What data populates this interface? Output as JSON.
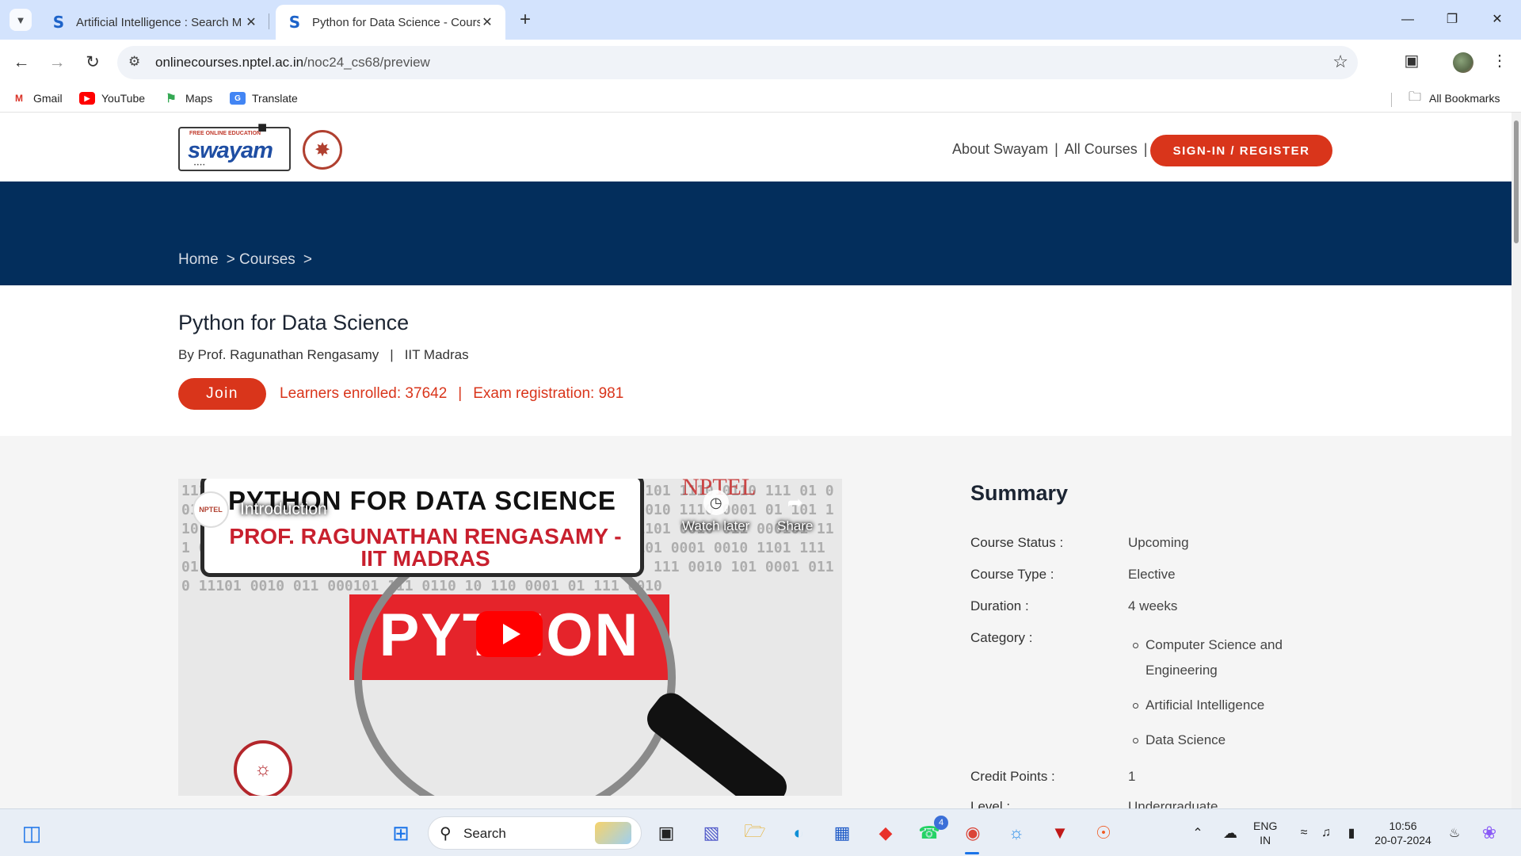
{
  "browser": {
    "tabs": [
      {
        "title": "Artificial Intelligence : Search M",
        "favicon": "S",
        "active": false
      },
      {
        "title": "Python for Data Science - Cours",
        "favicon": "S",
        "active": true
      }
    ],
    "url_host": "onlinecourses.nptel.ac.in",
    "url_path": "/noc24_cs68/preview",
    "bookmarks": [
      {
        "label": "Gmail",
        "icon": "gmail-icon"
      },
      {
        "label": "YouTube",
        "icon": "youtube-icon"
      },
      {
        "label": "Maps",
        "icon": "maps-icon"
      },
      {
        "label": "Translate",
        "icon": "translate-icon"
      }
    ],
    "all_bookmarks": "All Bookmarks"
  },
  "header": {
    "logo_text": "swayam",
    "logo_tagline": "FREE ONLINE EDUCATION",
    "nav": [
      "About Swayam",
      "All Courses"
    ],
    "signin": "SIGN-IN / REGISTER"
  },
  "breadcrumb": [
    "Home",
    "> Courses",
    ">"
  ],
  "course": {
    "title": "Python for Data Science",
    "instructor": "By Prof. Ragunathan Rengasamy",
    "institute": "IIT Madras",
    "join": "Join",
    "learners": "Learners enrolled: 37642",
    "exam": "Exam registration: 981"
  },
  "video": {
    "banner_title": "PYTHON FOR DATA SCIENCE",
    "banner_prof": "PROF. RAGUNATHAN RENGASAMY - IIT MADRAS",
    "big_text": "PYTHON",
    "intro_title": "Introduction",
    "channel": "NPTEL",
    "watermark": "NPTEL",
    "watch_later": "Watch later",
    "share": "Share"
  },
  "summary": {
    "heading": "Summary",
    "rows": [
      {
        "label": "Course Status :",
        "value": "Upcoming"
      },
      {
        "label": "Course Type :",
        "value": "Elective"
      },
      {
        "label": "Duration :",
        "value": "4 weeks"
      },
      {
        "label": "Category :",
        "value": ""
      },
      {
        "label": "Credit Points :",
        "value": "1"
      },
      {
        "label": "Level :",
        "value": "Undergraduate"
      }
    ],
    "categories": [
      "Computer Science and Engineering",
      "Artificial Intelligence",
      "Data Science"
    ]
  },
  "taskbar": {
    "search": "Search",
    "whatsapp_badge": "4",
    "lang_top": "ENG",
    "lang_bottom": "IN",
    "time": "10:56",
    "date": "20-07-2024"
  },
  "colors": {
    "accent_red": "#d9351b",
    "hero_navy": "#032e5c",
    "chrome_tabbar": "#d3e3fd"
  }
}
